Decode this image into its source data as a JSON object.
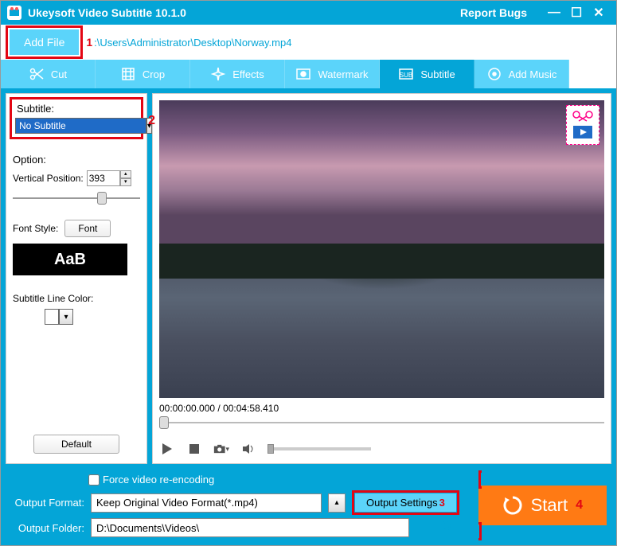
{
  "titlebar": {
    "title": "Ukeysoft Video Subtitle 10.1.0",
    "report": "Report Bugs"
  },
  "addfile": {
    "label": "Add File",
    "num": "1",
    "path": ":\\Users\\Administrator\\Desktop\\Norway.mp4"
  },
  "tabs": {
    "cut": "Cut",
    "crop": "Crop",
    "effects": "Effects",
    "watermark": "Watermark",
    "subtitle": "Subtitle",
    "addmusic": "Add Music"
  },
  "left": {
    "subtitle_label": "Subtitle:",
    "subtitle_value": "No Subtitle",
    "num2": "2",
    "option_label": "Option:",
    "vpos_label": "Vertical Position:",
    "vpos_value": "393",
    "fontstyle_label": "Font Style:",
    "font_btn": "Font",
    "font_preview": "AaB",
    "linecolor_label": "Subtitle Line Color:",
    "default_btn": "Default"
  },
  "video": {
    "time": "00:00:00.000 / 00:04:58.410"
  },
  "bottom": {
    "force_label": "Force video re-encoding",
    "format_label": "Output Format:",
    "format_value": "Keep Original Video Format(*.mp4)",
    "settings_label": "Output Settings",
    "num3": "3",
    "folder_label": "Output Folder:",
    "folder_value": "D:\\Documents\\Videos\\",
    "start_label": "Start",
    "num4": "4"
  }
}
